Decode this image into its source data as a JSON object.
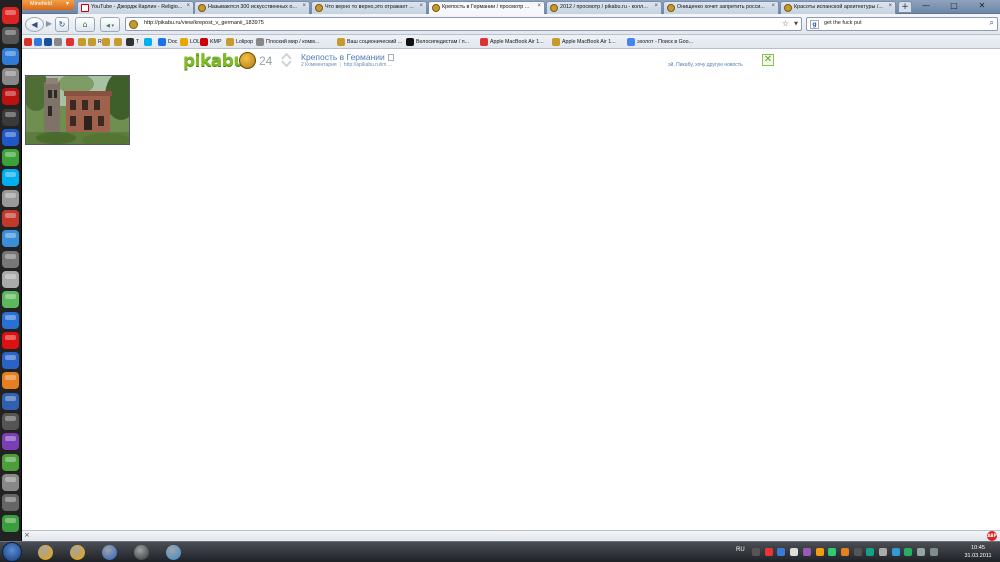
{
  "browser": {
    "app_button": "Minefield",
    "tabs": [
      {
        "title": "YouTube - Джордж Карлин - Religio...",
        "icon": "youtube-icon",
        "active": false
      },
      {
        "title": "Называются 300 искусственных о...",
        "icon": "pikabu-favicon",
        "active": false
      },
      {
        "title": "Что верно то верно,это отражает ...",
        "icon": "pikabu-favicon",
        "active": false
      },
      {
        "title": "Крепость в Германии / просмотр ...",
        "icon": "pikabu-favicon",
        "active": true
      },
      {
        "title": "2012 / просмотр / pikabu.ru - колл...",
        "icon": "pikabu-favicon",
        "active": false
      },
      {
        "title": "Онищенко хочет запретить росси...",
        "icon": "pikabu-favicon",
        "active": false
      },
      {
        "title": "Красоты испанской архитектуры /...",
        "icon": "pikabu-favicon",
        "active": false
      }
    ],
    "new_tab": "+",
    "window_controls": {
      "minimize": "—",
      "maximize": "□",
      "close": "✕"
    },
    "url": "http://pikabu.ru/view/krepost_v_germanii_183975",
    "search_text": "get the fuck put",
    "bookmarks": [
      {
        "label": "",
        "icon": "gmail-icon",
        "color": "#d93025"
      },
      {
        "label": "",
        "icon": "ie-icon",
        "color": "#2f7bd6"
      },
      {
        "label": "",
        "icon": "mail-icon",
        "color": "#1a4f9c"
      },
      {
        "label": "",
        "icon": "settings-icon",
        "color": "#888888"
      },
      {
        "label": "",
        "icon": "chat-icon",
        "color": "#d33"
      },
      {
        "label": "",
        "icon": "pikabu-icon",
        "color": "#c79b2b"
      },
      {
        "label": "R",
        "icon": "pikabu-icon",
        "color": "#c79b2b"
      },
      {
        "label": "",
        "icon": "pikabu-icon",
        "color": "#c79b2b"
      },
      {
        "label": "",
        "icon": "pikabu-icon",
        "color": "#c79b2b"
      },
      {
        "label": "T",
        "icon": "music-icon",
        "color": "#333333"
      },
      {
        "label": "",
        "icon": "skype-icon",
        "color": "#00aff0"
      },
      {
        "label": "Doc",
        "icon": "doc-icon",
        "color": "#1a73e8"
      },
      {
        "label": "LOL",
        "icon": "smile-icon",
        "color": "#e6a800"
      },
      {
        "label": "KMP",
        "icon": "youtube-icon",
        "color": "#c00"
      },
      {
        "label": "Lolipop",
        "icon": "pikabu-icon",
        "color": "#c79b2b"
      },
      {
        "label": "Плоский мир / комм...",
        "icon": "page-icon",
        "color": "#888888"
      },
      {
        "label": "Ваш соционический ...",
        "icon": "pikabu-icon",
        "color": "#c79b2b"
      },
      {
        "label": "Велосипедистам / п...",
        "icon": "apple-icon",
        "color": "#111111"
      },
      {
        "label": "Apple MacBook Air 1...",
        "icon": "chrome-icon",
        "color": "#d33"
      },
      {
        "label": "Apple MacBook Air 1...",
        "icon": "pikabu-icon",
        "color": "#c79b2b"
      },
      {
        "label": "эхолот - Поиск в Goo...",
        "icon": "google-icon",
        "color": "#4285f4"
      }
    ]
  },
  "pikabu": {
    "logo_text": "pikabu",
    "rating": "24",
    "post_title": "Крепость в Германии",
    "comments_link": "2 Комментария",
    "source_link": "http://apikabu.ru/im ...",
    "other_news_link": "эй, Пикабу, хочу другую новость",
    "close_glyph": "✕"
  },
  "status": {
    "close_glyph": "×",
    "abp_label": "ABP"
  },
  "taskbar": {
    "lang": "RU",
    "time": "10:45",
    "date": "31.03.2011",
    "pinned": [
      {
        "name": "aimp-icon",
        "color": "#f2a900"
      },
      {
        "name": "aimp2-icon",
        "color": "#f2a900"
      },
      {
        "name": "firefox-icon",
        "color": "#2a63c8"
      },
      {
        "name": "assassin-icon",
        "color": "#333"
      },
      {
        "name": "itunes-icon",
        "color": "#3a8fd8"
      }
    ]
  },
  "dock": [
    {
      "name": "block-icon",
      "color": "#d22"
    },
    {
      "name": "pc-icon",
      "color": "#555"
    },
    {
      "name": "ie-logo-icon",
      "color": "#2f7bd6"
    },
    {
      "name": "game-icon",
      "color": "#888"
    },
    {
      "name": "bomb-icon",
      "color": "#b11"
    },
    {
      "name": "steam-icon",
      "color": "#3a3a3a"
    },
    {
      "name": "lightning-icon",
      "color": "#1e58c7"
    },
    {
      "name": "utorrent-icon",
      "color": "#3aa236"
    },
    {
      "name": "skype-icon",
      "color": "#00aff0"
    },
    {
      "name": "m-app-icon",
      "color": "#999"
    },
    {
      "name": "64-icon",
      "color": "#c0392b"
    },
    {
      "name": "itunes-icon",
      "color": "#3a8fd8"
    },
    {
      "name": "fun-icon",
      "color": "#777"
    },
    {
      "name": "disc-icon",
      "color": "#aaa"
    },
    {
      "name": "leaf-icon",
      "color": "#5cb85c"
    },
    {
      "name": "hd-icon",
      "color": "#2a6fd6"
    },
    {
      "name": "opera-icon",
      "color": "#d11"
    },
    {
      "name": "globe-icon",
      "color": "#2a63c8"
    },
    {
      "name": "l-app-icon",
      "color": "#e67e22"
    },
    {
      "name": "l2-app-icon",
      "color": "#3060b0"
    },
    {
      "name": "game99-icon",
      "color": "#555"
    },
    {
      "name": "cpuz-icon",
      "color": "#7b3fb5"
    },
    {
      "name": "monitor-icon",
      "color": "#4c9f38"
    },
    {
      "name": "tower-icon",
      "color": "#888"
    },
    {
      "name": "camera-icon",
      "color": "#666"
    },
    {
      "name": "green-app-icon",
      "color": "#3c9d3c"
    }
  ]
}
